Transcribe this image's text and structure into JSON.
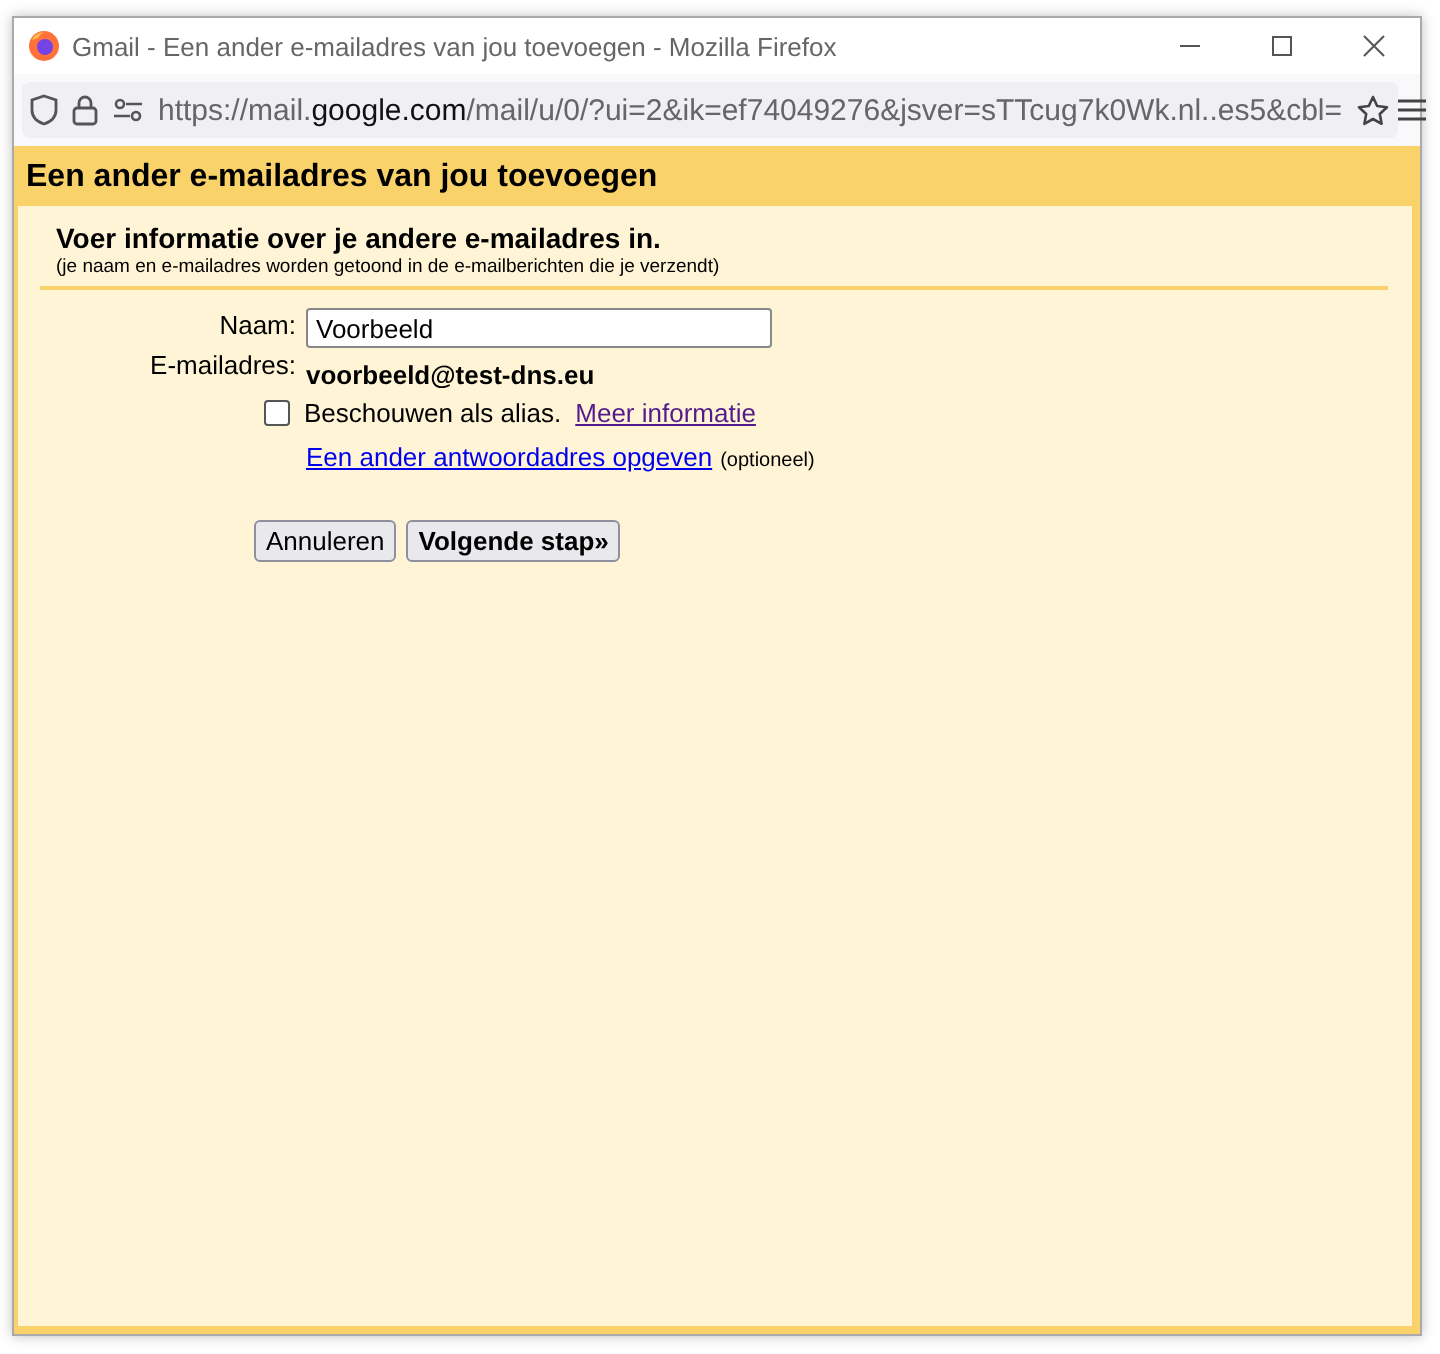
{
  "window": {
    "title": "Gmail - Een ander e-mailadres van jou toevoegen - Mozilla Firefox"
  },
  "address_bar": {
    "url_prefix": "https://mail.",
    "url_domain": "google.com",
    "url_rest": "/mail/u/0/?ui=2&ik=ef74049276&jsver=sTTcug7k0Wk.nl..es5&cbl="
  },
  "dialog": {
    "title": "Een ander e-mailadres van jou toevoegen",
    "heading": "Voer informatie over je andere e-mailadres in.",
    "subheading": "(je naam en e-mailadres worden getoond in de e-mailberichten die je verzendt)"
  },
  "form": {
    "name_label": "Naam:",
    "name_value": "Voorbeeld",
    "email_label": "E-mailadres:",
    "email_value": "voorbeeld@test-dns.eu",
    "alias": {
      "label": "Beschouwen als alias.",
      "checked": false,
      "link": "Meer informatie"
    },
    "reply_link": "Een ander antwoordadres opgeven",
    "reply_note": "(optioneel)"
  },
  "buttons": [
    {
      "label": "Annuleren",
      "kind": "normal"
    },
    {
      "label": "Volgende stap»",
      "kind": "primary"
    }
  ]
}
